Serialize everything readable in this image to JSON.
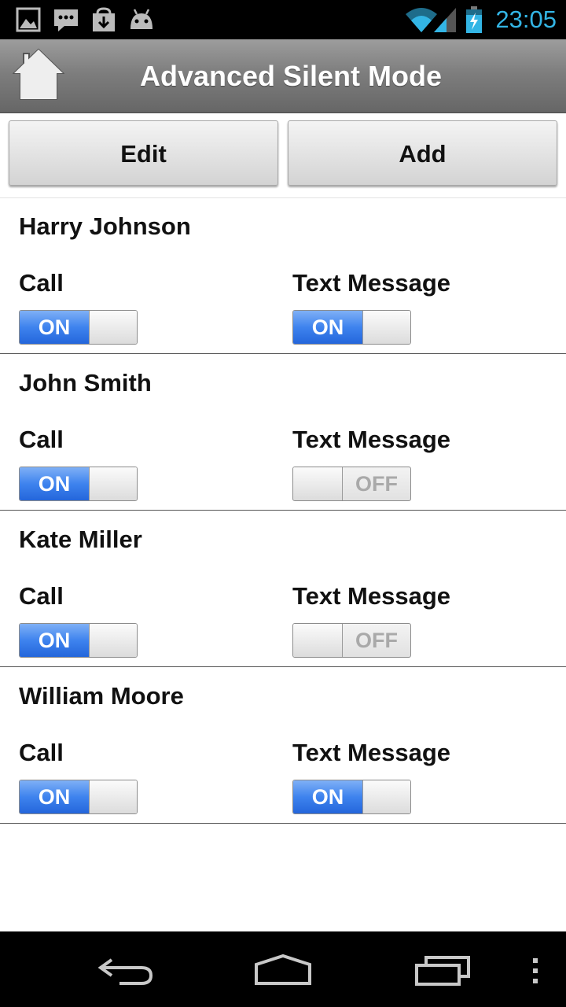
{
  "status_bar": {
    "time": "23:05",
    "left_icons": [
      "picture-icon",
      "chat-icon",
      "download-icon",
      "android-icon"
    ],
    "right_icons": [
      "wifi-icon",
      "signal-icon",
      "battery-charging-icon"
    ],
    "time_color": "#33b5e5"
  },
  "action_bar": {
    "title": "Advanced Silent Mode",
    "icon": "home-icon"
  },
  "toolbar": {
    "edit_label": "Edit",
    "add_label": "Add"
  },
  "contacts": [
    {
      "name": "Harry Johnson",
      "call_label": "Call",
      "text_label": "Text Message",
      "call_state": "ON",
      "text_state": "ON"
    },
    {
      "name": "John Smith",
      "call_label": "Call",
      "text_label": "Text Message",
      "call_state": "ON",
      "text_state": "OFF"
    },
    {
      "name": "Kate Miller",
      "call_label": "Call",
      "text_label": "Text Message",
      "call_state": "ON",
      "text_state": "OFF"
    },
    {
      "name": "William Moore",
      "call_label": "Call",
      "text_label": "Text Message",
      "call_state": "ON",
      "text_state": "ON"
    }
  ],
  "toggle_text": {
    "on": "ON",
    "off": "OFF"
  },
  "nav_bar": {
    "icons": [
      "back-icon",
      "home-icon",
      "recent-apps-icon",
      "overflow-menu-icon"
    ]
  },
  "colors": {
    "toggle_on": "#3e83ee",
    "action_bar": "#7e7e7e"
  }
}
